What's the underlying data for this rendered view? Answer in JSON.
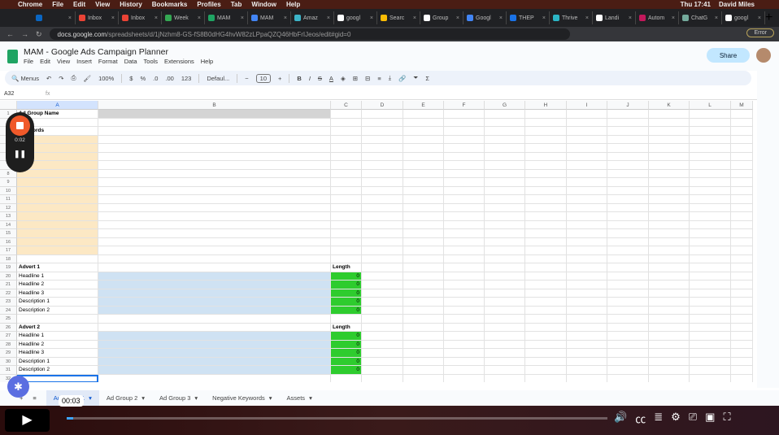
{
  "mac_menu": {
    "items": [
      "Chrome",
      "File",
      "Edit",
      "View",
      "History",
      "Bookmarks",
      "Profiles",
      "Tab",
      "Window",
      "Help"
    ],
    "clock": "Thu 17:41",
    "user": "David Miles"
  },
  "browser": {
    "tabs": [
      {
        "label": "",
        "color": "#0a66c2"
      },
      {
        "label": "Inbox",
        "color": "#ea4335"
      },
      {
        "label": "Inbox",
        "color": "#ea4335"
      },
      {
        "label": "Week",
        "color": "#34a853"
      },
      {
        "label": "MAM",
        "color": "#1fa463"
      },
      {
        "label": "MAM",
        "color": "#4285f4"
      },
      {
        "label": "Amaz",
        "color": "#3cb4c8"
      },
      {
        "label": "googl",
        "color": "#ffffff"
      },
      {
        "label": "Searc",
        "color": "#fbbc04"
      },
      {
        "label": "Group",
        "color": "#ffffff"
      },
      {
        "label": "Googl",
        "color": "#4285f4"
      },
      {
        "label": "THEP",
        "color": "#1a73e8"
      },
      {
        "label": "Thrive",
        "color": "#2bb5c5"
      },
      {
        "label": "Landi",
        "color": "#ffffff"
      },
      {
        "label": "Autom",
        "color": "#c2185b"
      },
      {
        "label": "ChatG",
        "color": "#74aa9c"
      },
      {
        "label": "googl",
        "color": "#ffffff"
      }
    ],
    "url_host": "docs.google.com",
    "url_path": "/spreadsheets/d/1jNzhm8-GS-fS8B0dHG4hvW82zLPpaQZQ46HbFrIJeos/edit#gid=0",
    "error_label": "Error"
  },
  "doc": {
    "title": "MAM - Google Ads Campaign Planner",
    "menus": [
      "File",
      "Edit",
      "View",
      "Insert",
      "Format",
      "Data",
      "Tools",
      "Extensions",
      "Help"
    ],
    "share_label": "Share"
  },
  "toolbar": {
    "search": "Menus",
    "zoom": "100%",
    "currency": "$",
    "percent": "%",
    "dec_minus": ".0",
    "dec_plus": ".00",
    "number_format": "123",
    "font": "Defaul...",
    "font_size": "10",
    "bold": "B",
    "italic": "I"
  },
  "formula_bar": {
    "cell_ref": "A32",
    "fx": "fx",
    "value": ""
  },
  "sheet": {
    "columns": [
      "A",
      "B",
      "C",
      "D",
      "E",
      "F",
      "G",
      "H",
      "I",
      "J",
      "K",
      "L",
      "M"
    ],
    "selected_cell": "A32",
    "colors": {
      "yellow": "#fce8c4",
      "blue": "#cfe2f3",
      "green": "#2ecc2e",
      "gray": "#d4d4d4"
    },
    "cells": [
      {
        "row": 1,
        "col": "A",
        "text": "Ad Group Name",
        "bold": true
      },
      {
        "row": 3,
        "col": "A",
        "text": "Keywords",
        "bold": true
      },
      {
        "row": 19,
        "col": "A",
        "text": "Advert 1",
        "bold": true
      },
      {
        "row": 19,
        "col": "C",
        "text": "Length",
        "bold": true
      },
      {
        "row": 20,
        "col": "A",
        "text": "Headline 1"
      },
      {
        "row": 20,
        "col": "C",
        "text": "0"
      },
      {
        "row": 21,
        "col": "A",
        "text": "Headline 2"
      },
      {
        "row": 21,
        "col": "C",
        "text": "0"
      },
      {
        "row": 22,
        "col": "A",
        "text": "Headline 3"
      },
      {
        "row": 22,
        "col": "C",
        "text": "0"
      },
      {
        "row": 23,
        "col": "A",
        "text": "Description 1"
      },
      {
        "row": 23,
        "col": "C",
        "text": "0"
      },
      {
        "row": 24,
        "col": "A",
        "text": "Description 2"
      },
      {
        "row": 24,
        "col": "C",
        "text": "0"
      },
      {
        "row": 26,
        "col": "A",
        "text": "Advert 2",
        "bold": true
      },
      {
        "row": 26,
        "col": "C",
        "text": "Length",
        "bold": true
      },
      {
        "row": 27,
        "col": "A",
        "text": "Headline 1"
      },
      {
        "row": 27,
        "col": "C",
        "text": "0"
      },
      {
        "row": 28,
        "col": "A",
        "text": "Headline 2"
      },
      {
        "row": 28,
        "col": "C",
        "text": "0"
      },
      {
        "row": 29,
        "col": "A",
        "text": "Headline 3"
      },
      {
        "row": 29,
        "col": "C",
        "text": "0"
      },
      {
        "row": 30,
        "col": "A",
        "text": "Description 1"
      },
      {
        "row": 30,
        "col": "C",
        "text": "0"
      },
      {
        "row": 31,
        "col": "A",
        "text": "Description 2"
      },
      {
        "row": 31,
        "col": "C",
        "text": "0"
      }
    ]
  },
  "sheet_tabs": [
    "Ad Group 1",
    "Ad Group 2",
    "Ad Group 3",
    "Negative Keywords",
    "Assets"
  ],
  "recorder": {
    "time": "0:02"
  },
  "video": {
    "time": "00:03",
    "progress_fraction": 0.005
  }
}
